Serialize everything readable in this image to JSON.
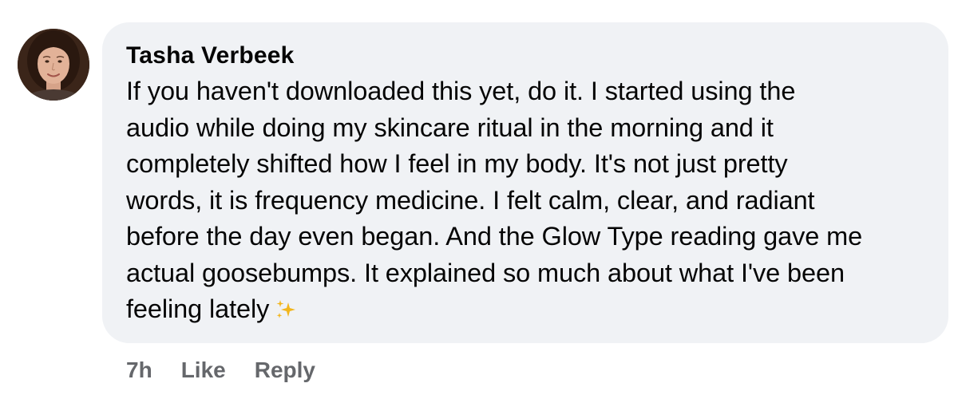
{
  "comment": {
    "author": "Tasha Verbeek",
    "body": "If you haven't downloaded this yet, do it. I started using the\naudio while doing my skincare ritual in the morning and it\ncompletely shifted how I feel in my body. It's not just pretty\nwords, it is frequency medicine. I felt calm, clear, and radiant\nbefore the day even began. And the Glow Type reading gave me\nactual goosebumps. It explained so much about what I've been\nfeeling lately",
    "trailing_emoji": "sparkles-icon",
    "timestamp": "7h",
    "like_label": "Like",
    "reply_label": "Reply"
  },
  "colors": {
    "bubble_background": "#f0f2f5",
    "text": "#050505",
    "meta_text": "#65676b",
    "sparkle": "#f2b61c"
  }
}
